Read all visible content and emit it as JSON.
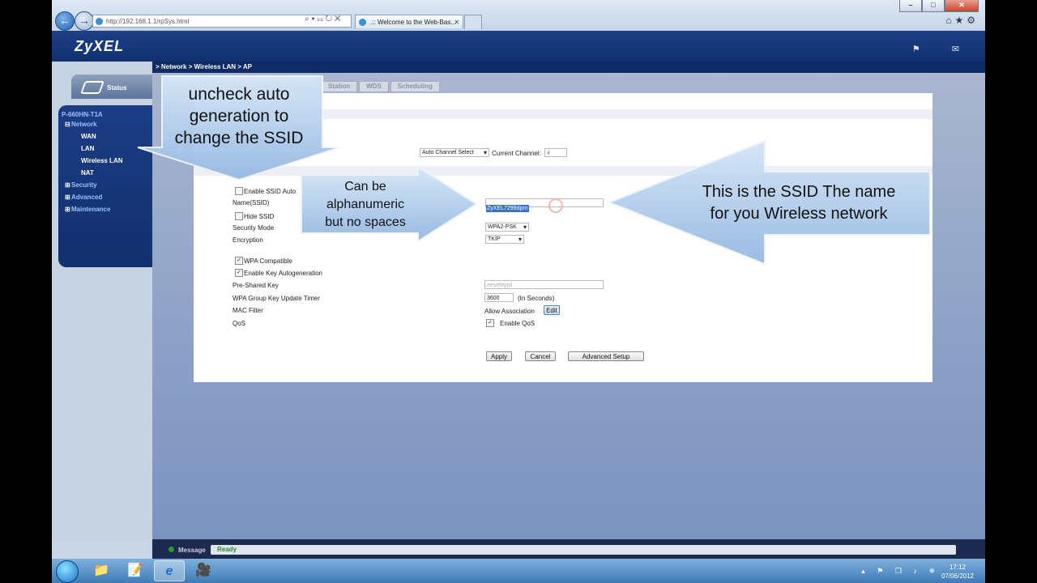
{
  "browser": {
    "window_controls": {
      "minimize": "–",
      "maximize": "□",
      "close": "✕"
    },
    "back_icon": "arrow-left-icon",
    "forward_icon": "arrow-right-icon",
    "address": "http://192.168.1.1/rpSys.html",
    "address_tools": "⌕ ▾ ☷ ↻ ✕",
    "tab_title": ".:: Welcome to the Web-Bas...",
    "tab_close": "✕",
    "toolbar_icons": "⌂★⚙"
  },
  "router": {
    "logo": "ZyXEL",
    "header_icons": "⚑ ✉",
    "breadcrumb": "> Network > Wireless LAN > AP",
    "status_label": "Status",
    "model": "P-660HN-T1A",
    "nav": {
      "network": "Network",
      "wan": "WAN",
      "lan": "LAN",
      "wireless_lan": "Wireless LAN",
      "nat": "NAT",
      "security": "Security",
      "advanced": "Advanced",
      "maintenance": "Maintenance"
    },
    "tabs": [
      "Station",
      "WDS",
      "Scheduling"
    ]
  },
  "form": {
    "channel_select": "Auto Channel Select",
    "current_channel_label": "Current Channel:",
    "current_channel_value": "4",
    "enable_ssid_auto": "Enable SSID Auto",
    "name_ssid": "Name(SSID)",
    "ssid_value": "ZyXEL7299dprn",
    "hide_ssid": "Hide SSID",
    "security_mode": "Security Mode",
    "security_mode_value": "WPA2-PSK",
    "encryption": "Encryption",
    "encryption_value": "TKIP",
    "wpa_compatible": "WPA Compatible",
    "enable_key_autogen": "Enable Key Autogeneration",
    "pre_shared_key": "Pre-Shared Key",
    "pre_shared_key_value": "eesebtyjsl",
    "wpa_group_key_timer": "WPA Group Key Update Timer",
    "timer_value": "3600",
    "timer_unit": "(In Seconds)",
    "mac_filter": "MAC Filter",
    "allow_association": "Allow Association",
    "edit": "Edit",
    "qos": "QoS",
    "enable_qos": "Enable QoS",
    "apply": "Apply",
    "cancel": "Cancel",
    "advanced_setup": "Advanced Setup",
    "checked_mark": "✓"
  },
  "callouts": {
    "left": [
      "uncheck auto",
      "generation to",
      "change the SSID"
    ],
    "middle": [
      "Can be",
      "alphanumeric",
      "but no spaces"
    ],
    "right": [
      "This is the SSID The name",
      "for you Wireless network"
    ]
  },
  "statusbar": {
    "message_label": "Message",
    "message_value": "Ready"
  },
  "taskbar": {
    "clock_time": "17:12",
    "clock_date": "07/06/2012",
    "tray_icons": "▴ ⚑ ❐ ♪ ✵"
  },
  "colors": {
    "brand_navy": "#13306e",
    "callout_blue": "#a4c4e8",
    "selection_blue": "#3a6fd3"
  }
}
